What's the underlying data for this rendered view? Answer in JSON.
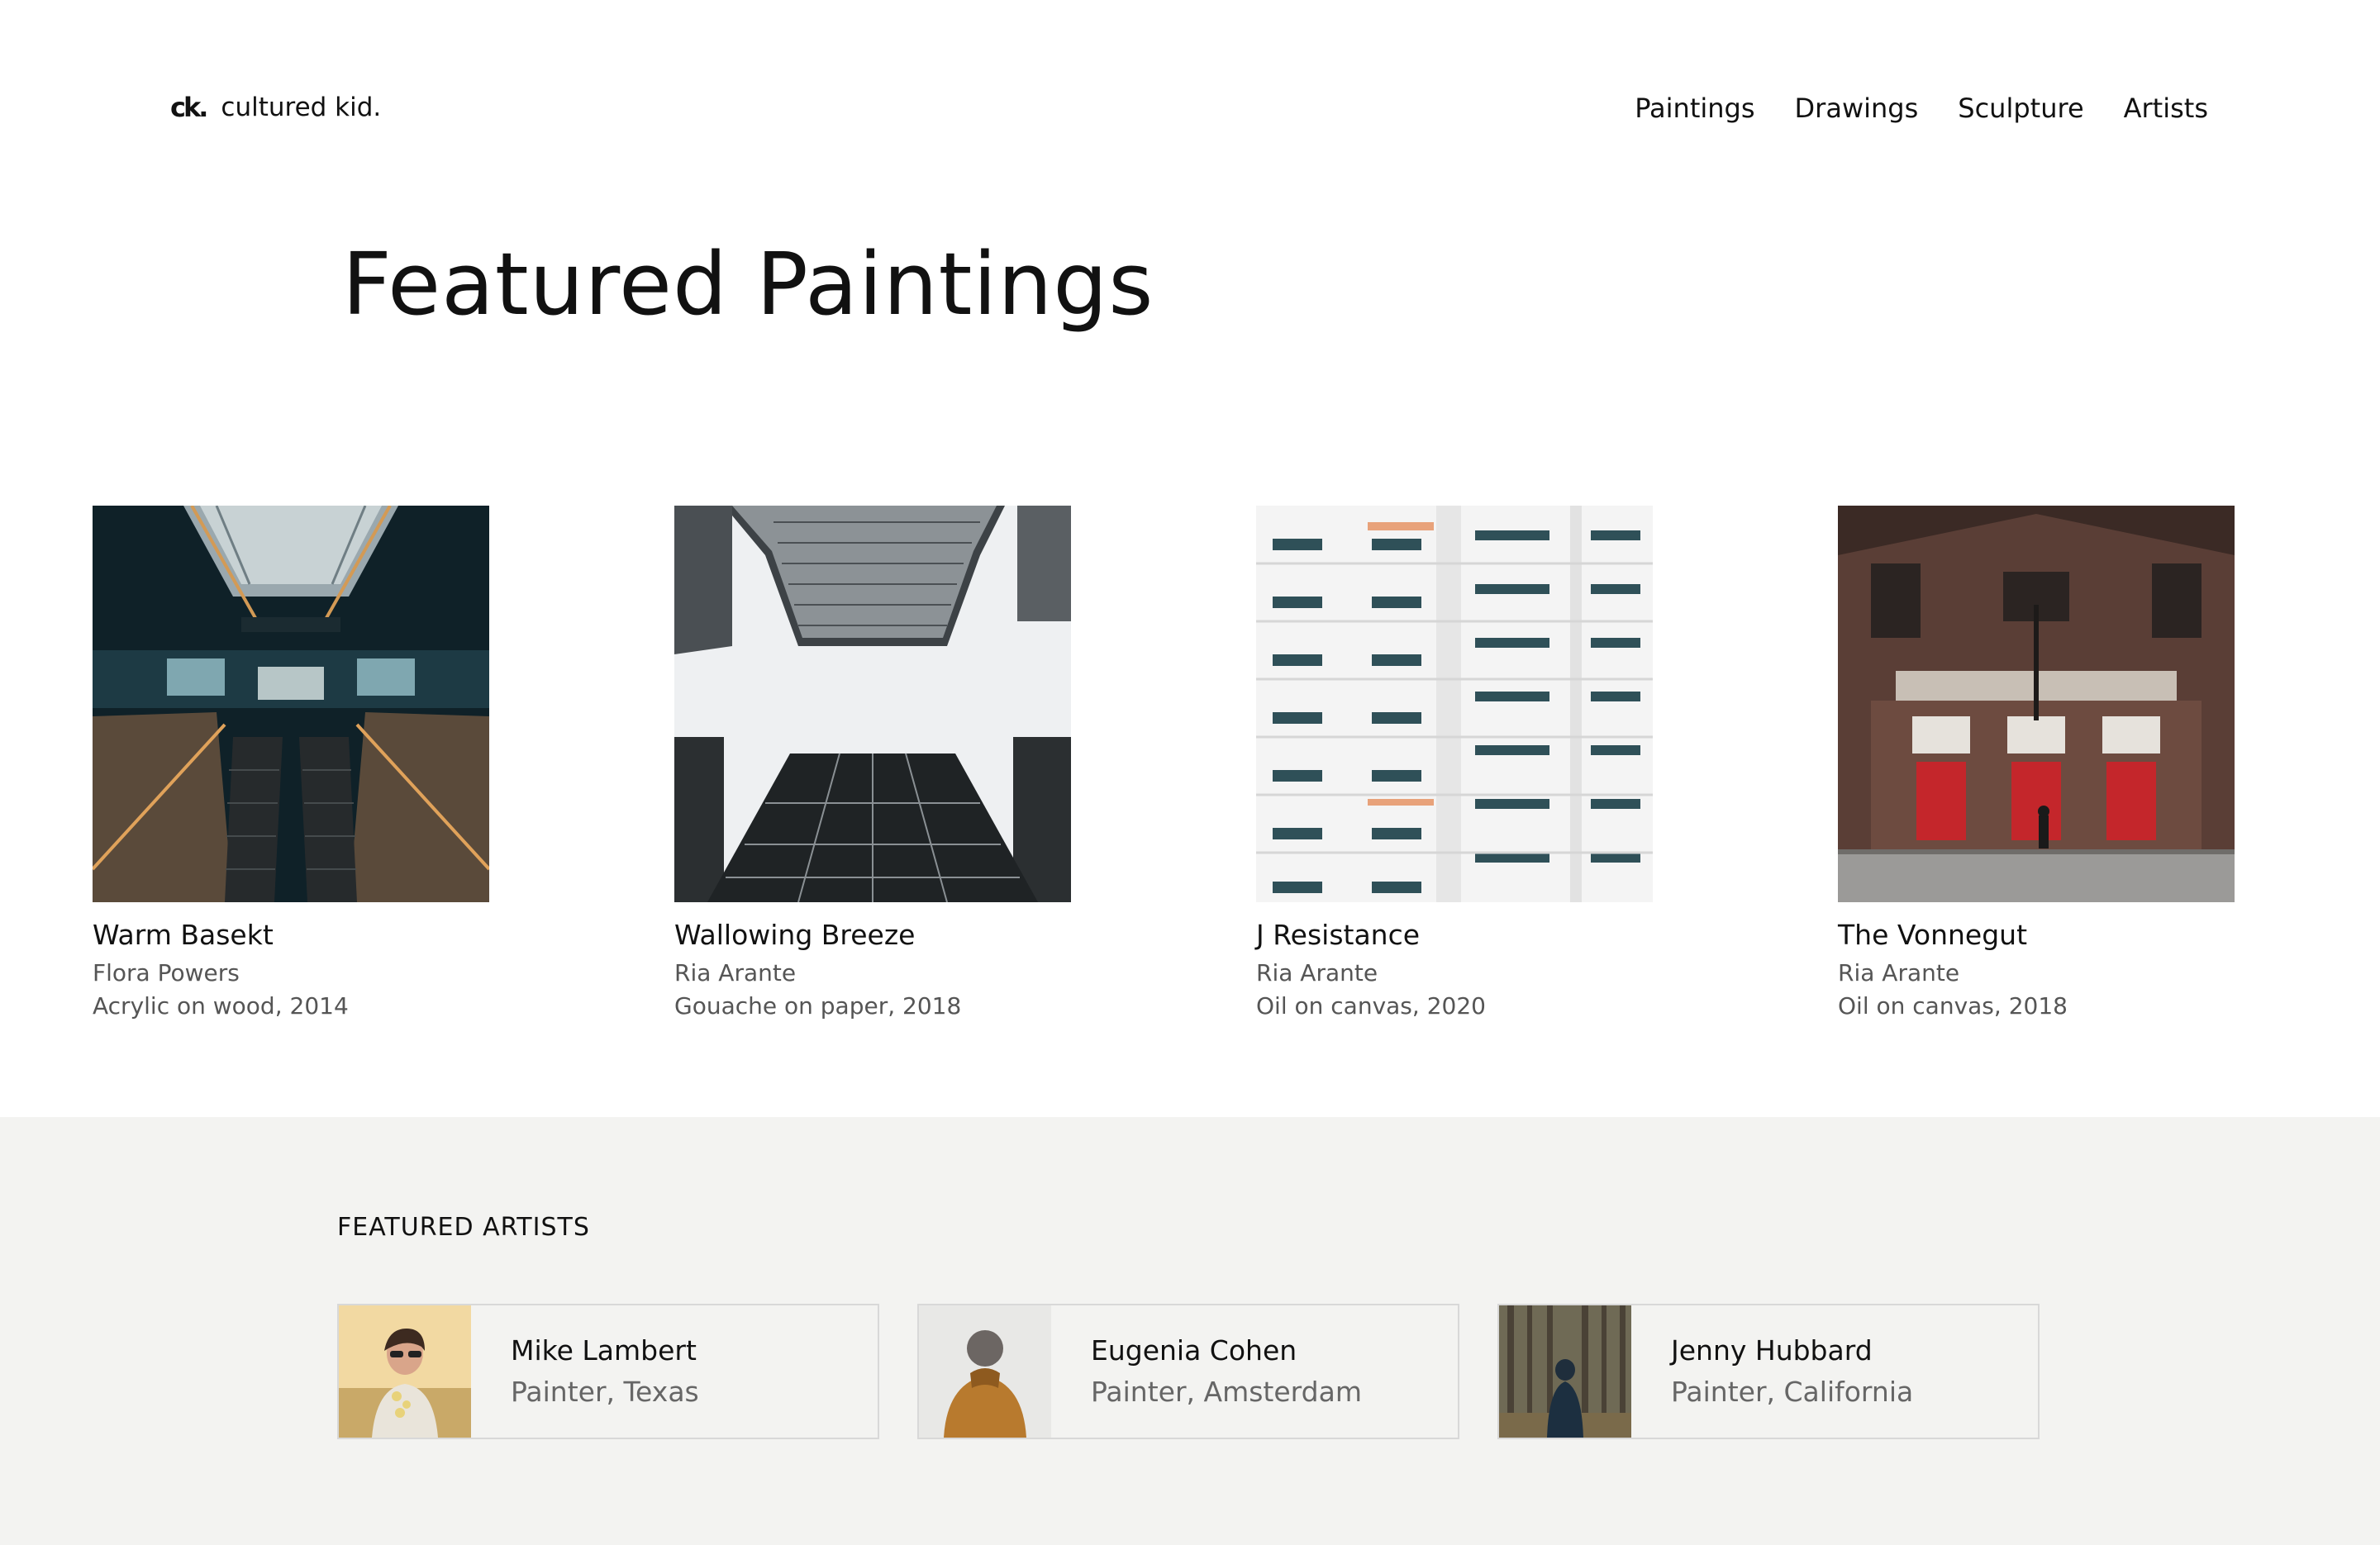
{
  "brand": {
    "mark": "ck.",
    "name": "cultured kid."
  },
  "nav": {
    "items": [
      "Paintings",
      "Drawings",
      "Sculpture",
      "Artists"
    ]
  },
  "page": {
    "title": "Featured Paintings"
  },
  "paintings": [
    {
      "title": "Warm Basekt",
      "artist": "Flora Powers",
      "medium": "Acrylic on wood, 2014"
    },
    {
      "title": "Wallowing Breeze",
      "artist": "Ria Arante",
      "medium": "Gouache on paper, 2018"
    },
    {
      "title": "J Resistance",
      "artist": "Ria Arante",
      "medium": "Oil on canvas, 2020"
    },
    {
      "title": "The Vonnegut",
      "artist": "Ria Arante",
      "medium": "Oil on canvas, 2018"
    }
  ],
  "artists_section": {
    "label": "FEATURED ARTISTS",
    "artists": [
      {
        "name": "Mike Lambert",
        "role": "Painter, Texas"
      },
      {
        "name": "Eugenia Cohen",
        "role": "Painter, Amsterdam"
      },
      {
        "name": "Jenny Hubbard",
        "role": "Painter, California"
      }
    ]
  },
  "colors": {
    "background": "#ffffff",
    "section_bg": "#f3f3f1",
    "text": "#111111",
    "muted": "#555555"
  }
}
